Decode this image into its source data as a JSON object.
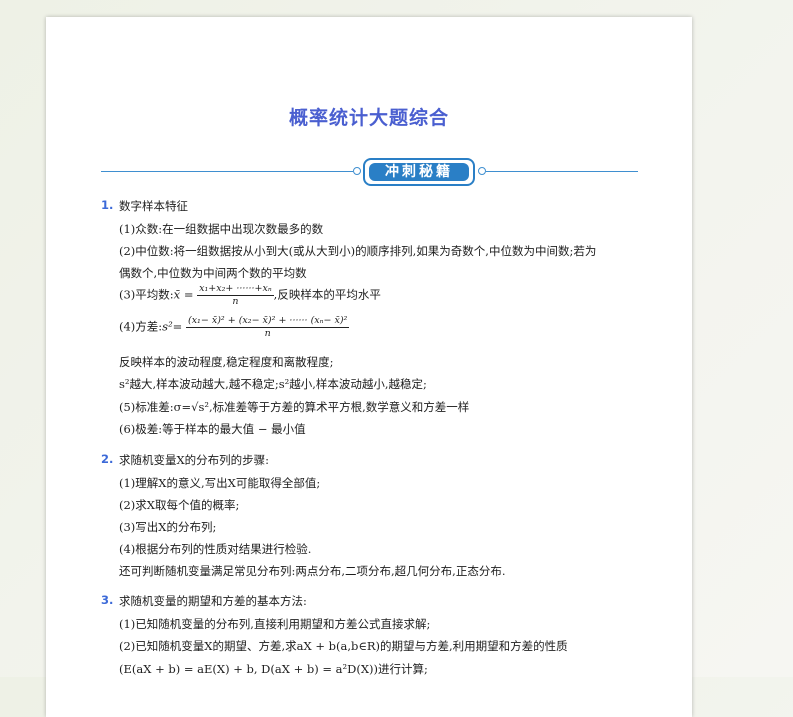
{
  "title": "概率统计大题综合",
  "banner": "冲刺秘籍",
  "sections": [
    {
      "num": "1.",
      "heading": "数字样本特征",
      "lines": [
        "(1)众数:在一组数据中出现次数最多的数",
        "(2)中位数:将一组数据按从小到大(或从大到小)的顺序排列,如果为奇数个,中位数为中间数;若为",
        "偶数个,中位数为中间两个数的平均数",
        "(3)平均数:",
        ",反映样本的平均水平",
        "(4)方差:",
        "反映样本的波动程度,稳定程度和离散程度;",
        "s²越大,样本波动越大,越不稳定;s²越小,样本波动越小,越稳定;",
        "(5)标准差:σ=√s²,标准差等于方差的算术平方根,数学意义和方差一样",
        "(6)极差:等于样本的最大值 − 最小值"
      ],
      "mean_formula": {
        "lhs": "x̄ =",
        "num": "x₁+x₂+ ······+xₙ",
        "den": "n"
      },
      "var_formula": {
        "lhs": "s²=",
        "num": "(x₁− x̄)² + (x₂− x̄)² + ······ (xₙ− x̄)²",
        "den": "n"
      }
    },
    {
      "num": "2.",
      "heading": "求随机变量X的分布列的步骤:",
      "lines": [
        "(1)理解X的意义,写出X可能取得全部值;",
        "(2)求X取每个值的概率;",
        "(3)写出X的分布列;",
        "(4)根据分布列的性质对结果进行检验.",
        "还可判断随机变量满足常见分布列:两点分布,二项分布,超几何分布,正态分布."
      ]
    },
    {
      "num": "3.",
      "heading": "求随机变量的期望和方差的基本方法:",
      "lines": [
        "(1)已知随机变量的分布列,直接利用期望和方差公式直接求解;",
        "(2)已知随机变量X的期望、方差,求aX + b(a,b∈R)的期望与方差,利用期望和方差的性质",
        "(E(aX + b) = aE(X) + b, D(aX + b) = a²D(X))进行计算;"
      ]
    }
  ]
}
